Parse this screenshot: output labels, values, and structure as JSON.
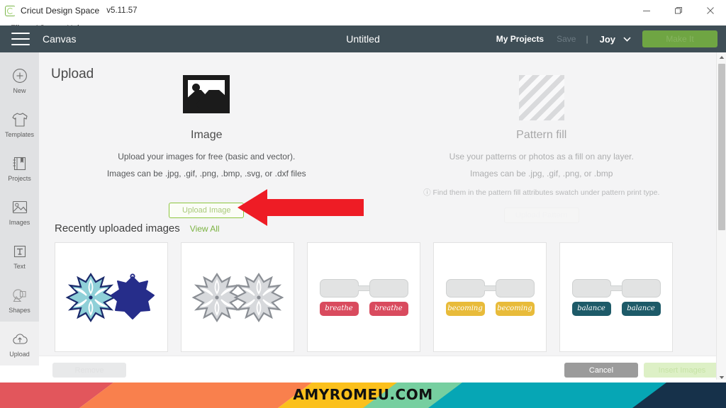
{
  "window": {
    "app_name": "Cricut Design Space",
    "version": "v5.11.57",
    "app_icon": "cricut-logo-icon",
    "controls": {
      "minimize": "minimize-icon",
      "maximize": "maximize-icon",
      "close": "close-icon"
    }
  },
  "menubar": {
    "items": [
      "File",
      "View",
      "Help"
    ]
  },
  "header": {
    "menu_icon": "hamburger-icon",
    "canvas_label": "Canvas",
    "doc_title": "Untitled",
    "my_projects": "My Projects",
    "save": "Save",
    "separator": "|",
    "machine": "Joy",
    "machine_chevron": "chevron-down-icon",
    "make_it": "Make It"
  },
  "sidebar": {
    "items": [
      {
        "label": "New",
        "icon": "plus-circle-icon",
        "active": false
      },
      {
        "label": "Templates",
        "icon": "tshirt-icon",
        "active": false
      },
      {
        "label": "Projects",
        "icon": "notebook-icon",
        "active": false
      },
      {
        "label": "Images",
        "icon": "picture-icon",
        "active": false
      },
      {
        "label": "Text",
        "icon": "text-t-icon",
        "active": false
      },
      {
        "label": "Shapes",
        "icon": "shapes-icon",
        "active": false
      },
      {
        "label": "Upload",
        "icon": "cloud-upload-icon",
        "active": true
      }
    ]
  },
  "panel": {
    "title": "Upload",
    "image_col": {
      "icon": "image-placeholder-icon",
      "heading": "Image",
      "line1": "Upload your images for free (basic and vector).",
      "line2": "Images can be .jpg, .gif, .png, .bmp, .svg, or .dxf files",
      "button": "Upload Image"
    },
    "pattern_col": {
      "icon": "diagonal-hatch-icon",
      "heading": "Pattern fill",
      "line1": "Use your patterns or photos as a fill on any layer.",
      "line2": "Images can be .jpg, .gif, .png, or .bmp",
      "note_icon": "info-icon",
      "note": "Find them in the pattern fill attributes swatch under pattern print type.",
      "button": "Upload Pattern"
    }
  },
  "recent": {
    "title": "Recently uploaded images",
    "view_all": "View All",
    "thumbnails": [
      {
        "name": "snowflake-ornament-blue",
        "kind": "snowflake-pair",
        "colors": {
          "detail": "#8fd0d8",
          "outline": "#1b2a6b",
          "solid": "#262d8a"
        }
      },
      {
        "name": "snowflake-ornament-grey",
        "kind": "snowflake-pair",
        "colors": {
          "detail": "#d7d9dc",
          "outline": "#8b8f95",
          "solid": "#d7d9dc"
        }
      },
      {
        "name": "tag-set-breathe",
        "kind": "tag-pair",
        "word": "breathe",
        "colors": {
          "chip": "#d94b5e",
          "tag": "#e2e3e3"
        }
      },
      {
        "name": "tag-set-becoming",
        "kind": "tag-pair",
        "word": "becoming",
        "colors": {
          "chip": "#e8bb3a",
          "tag": "#e2e3e3"
        }
      },
      {
        "name": "tag-set-balance",
        "kind": "tag-pair",
        "word": "balance",
        "colors": {
          "chip": "#1d5a68",
          "tag": "#e2e3e3"
        }
      }
    ]
  },
  "actions": {
    "remove": "Remove",
    "cancel": "Cancel",
    "insert": "Insert Images"
  },
  "scrollbar": {
    "up_arrow": "scroll-up-arrow-icon",
    "down_arrow": "scroll-down-arrow-icon",
    "thumb": "scrollbar-thumb"
  },
  "annotation": {
    "arrow": "red-arrow-pointing-left",
    "arrow_color": "#ee1c25"
  },
  "footer": {
    "watermark": "AMYROMEU.COM",
    "stripe_colors": [
      "#e2565c",
      "#f9804d",
      "#fbc01c",
      "#76cfa0",
      "#06a6b5",
      "#16314a"
    ]
  }
}
